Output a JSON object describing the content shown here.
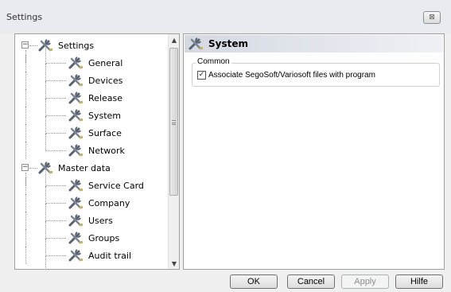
{
  "window": {
    "title": "Settings",
    "close_glyph": "⊠"
  },
  "tree": {
    "items": [
      {
        "label": "Settings",
        "level": 0,
        "expander": "−",
        "icon": "tools-icon"
      },
      {
        "label": "General",
        "level": 1,
        "icon": "tools-icon"
      },
      {
        "label": "Devices",
        "level": 1,
        "icon": "tools-icon"
      },
      {
        "label": "Release",
        "level": 1,
        "icon": "tools-icon"
      },
      {
        "label": "System",
        "level": 1,
        "icon": "tools-icon",
        "selected": true
      },
      {
        "label": "Surface",
        "level": 1,
        "icon": "tools-icon"
      },
      {
        "label": "Network",
        "level": 1,
        "icon": "tools-icon"
      },
      {
        "label": "Master data",
        "level": 0,
        "expander": "−",
        "icon": "tools-icon"
      },
      {
        "label": "Service Card",
        "level": 1,
        "icon": "tools-icon"
      },
      {
        "label": "Company",
        "level": 1,
        "icon": "tools-icon"
      },
      {
        "label": "Users",
        "level": 1,
        "icon": "tools-icon"
      },
      {
        "label": "Groups",
        "level": 1,
        "icon": "tools-icon"
      },
      {
        "label": "Audit trail",
        "level": 1,
        "icon": "tools-icon"
      }
    ],
    "scroll_up_glyph": "▲",
    "scroll_down_glyph": "▼"
  },
  "panel": {
    "title": "System",
    "group_label": "Common",
    "checkbox_label": "Associate SegoSoft/Variosoft files with program",
    "checkbox_checked": true,
    "check_glyph": "✓"
  },
  "buttons": {
    "ok": "OK",
    "cancel": "Cancel",
    "apply": "Apply",
    "help": "Hilfe"
  }
}
